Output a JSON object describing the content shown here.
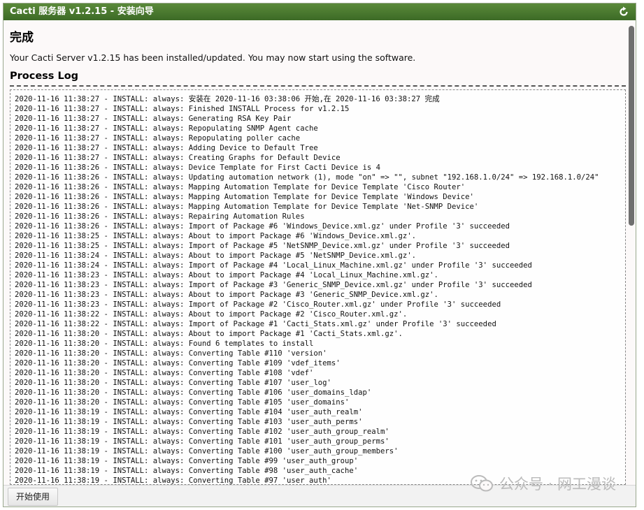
{
  "window": {
    "title": "Cacti 服务器 v1.2.15 - 安装向导"
  },
  "main": {
    "heading": "完成",
    "message": "Your Cacti Server v1.2.15 has been installed/updated. You may now start using the software.",
    "log_title": "Process Log",
    "log_lines": [
      "2020-11-16 11:38:27 - INSTALL: always: 安装在 2020-11-16 03:38:06 开始,在 2020-11-16 03:38:27 完成",
      "2020-11-16 11:38:27 - INSTALL: always: Finished INSTALL Process for v1.2.15",
      "2020-11-16 11:38:27 - INSTALL: always: Generating RSA Key Pair",
      "2020-11-16 11:38:27 - INSTALL: always: Repopulating SNMP Agent cache",
      "2020-11-16 11:38:27 - INSTALL: always: Repopulating poller cache",
      "2020-11-16 11:38:27 - INSTALL: always: Adding Device to Default Tree",
      "2020-11-16 11:38:27 - INSTALL: always: Creating Graphs for Default Device",
      "2020-11-16 11:38:26 - INSTALL: always: Device Template for First Cacti Device is 4",
      "2020-11-16 11:38:26 - INSTALL: always: Updating automation network (1), mode \"on\" => \"\", subnet \"192.168.1.0/24\" => 192.168.1.0/24\"",
      "2020-11-16 11:38:26 - INSTALL: always: Mapping Automation Template for Device Template 'Cisco Router'",
      "2020-11-16 11:38:26 - INSTALL: always: Mapping Automation Template for Device Template 'Windows Device'",
      "2020-11-16 11:38:26 - INSTALL: always: Mapping Automation Template for Device Template 'Net-SNMP Device'",
      "2020-11-16 11:38:26 - INSTALL: always: Repairing Automation Rules",
      "2020-11-16 11:38:26 - INSTALL: always: Import of Package #6 'Windows_Device.xml.gz' under Profile '3' succeeded",
      "2020-11-16 11:38:25 - INSTALL: always: About to import Package #6 'Windows_Device.xml.gz'.",
      "2020-11-16 11:38:25 - INSTALL: always: Import of Package #5 'NetSNMP_Device.xml.gz' under Profile '3' succeeded",
      "2020-11-16 11:38:24 - INSTALL: always: About to import Package #5 'NetSNMP_Device.xml.gz'.",
      "2020-11-16 11:38:24 - INSTALL: always: Import of Package #4 'Local_Linux_Machine.xml.gz' under Profile '3' succeeded",
      "2020-11-16 11:38:23 - INSTALL: always: About to import Package #4 'Local_Linux_Machine.xml.gz'.",
      "2020-11-16 11:38:23 - INSTALL: always: Import of Package #3 'Generic_SNMP_Device.xml.gz' under Profile '3' succeeded",
      "2020-11-16 11:38:23 - INSTALL: always: About to import Package #3 'Generic_SNMP_Device.xml.gz'.",
      "2020-11-16 11:38:23 - INSTALL: always: Import of Package #2 'Cisco_Router.xml.gz' under Profile '3' succeeded",
      "2020-11-16 11:38:22 - INSTALL: always: About to import Package #2 'Cisco_Router.xml.gz'.",
      "2020-11-16 11:38:22 - INSTALL: always: Import of Package #1 'Cacti_Stats.xml.gz' under Profile '3' succeeded",
      "2020-11-16 11:38:20 - INSTALL: always: About to import Package #1 'Cacti_Stats.xml.gz'.",
      "2020-11-16 11:38:20 - INSTALL: always: Found 6 templates to install",
      "2020-11-16 11:38:20 - INSTALL: always: Converting Table #110 'version'",
      "2020-11-16 11:38:20 - INSTALL: always: Converting Table #109 'vdef_items'",
      "2020-11-16 11:38:20 - INSTALL: always: Converting Table #108 'vdef'",
      "2020-11-16 11:38:20 - INSTALL: always: Converting Table #107 'user_log'",
      "2020-11-16 11:38:20 - INSTALL: always: Converting Table #106 'user_domains_ldap'",
      "2020-11-16 11:38:20 - INSTALL: always: Converting Table #105 'user_domains'",
      "2020-11-16 11:38:19 - INSTALL: always: Converting Table #104 'user_auth_realm'",
      "2020-11-16 11:38:19 - INSTALL: always: Converting Table #103 'user_auth_perms'",
      "2020-11-16 11:38:19 - INSTALL: always: Converting Table #102 'user_auth_group_realm'",
      "2020-11-16 11:38:19 - INSTALL: always: Converting Table #101 'user_auth_group_perms'",
      "2020-11-16 11:38:19 - INSTALL: always: Converting Table #100 'user_auth_group_members'",
      "2020-11-16 11:38:19 - INSTALL: always: Converting Table #99 'user_auth_group'",
      "2020-11-16 11:38:19 - INSTALL: always: Converting Table #98 'user_auth_cache'",
      "2020-11-16 11:38:19 - INSTALL: always: Converting Table #97 'user_auth'"
    ]
  },
  "footer": {
    "start_button": "开始使用"
  },
  "watermark": {
    "text": "公众号 · 网工漫谈"
  },
  "icons": {
    "refresh": "refresh-icon",
    "watermark": "wechat-icon"
  },
  "colors": {
    "titlebar": "#4a7a30",
    "scroll_thumb": "#6f6f6f"
  }
}
